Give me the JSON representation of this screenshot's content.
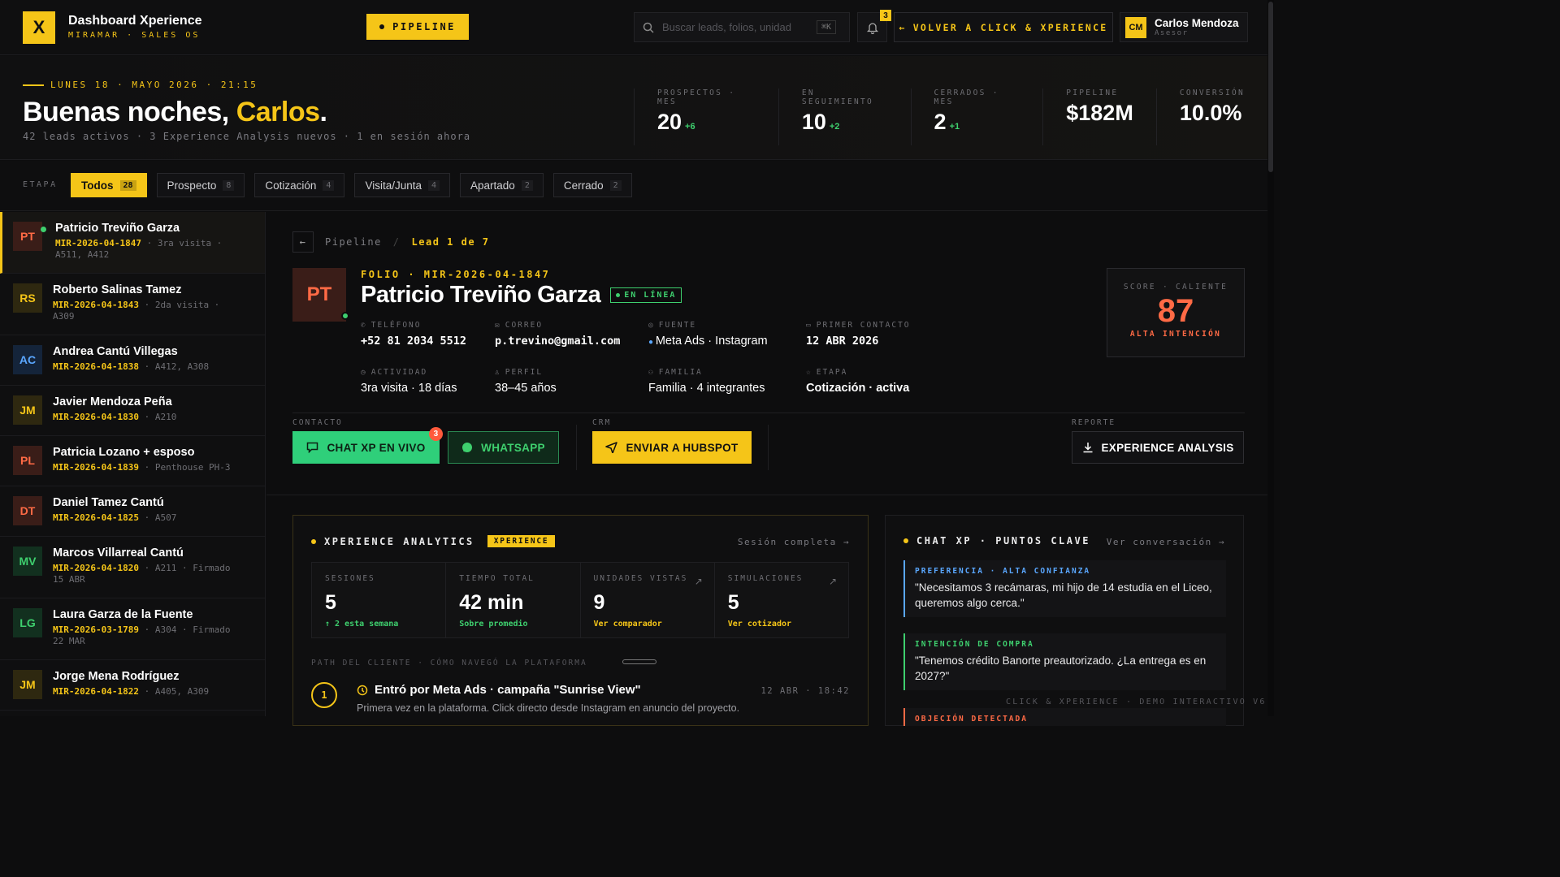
{
  "brand": {
    "logo": "X",
    "title": "Dashboard Xperience",
    "subtitle": "MIRAMAR · SALES OS"
  },
  "topbar": {
    "pipeline_label": "PIPELINE",
    "search_placeholder": "Buscar leads, folios, unidad",
    "search_shortcut": "⌘K",
    "notifications_count": "3",
    "back_label": "VOLVER A CLICK & XPERIENCE",
    "user": {
      "initials": "CM",
      "name": "Carlos Mendoza",
      "role": "Asesor"
    }
  },
  "hero": {
    "date": "LUNES 18 · MAYO 2026 · 21:15",
    "greeting_prefix": "Buenas noches, ",
    "greeting_name": "Carlos",
    "greeting_suffix": ".",
    "summary": "42 leads activos · 3 Experience Analysis nuevos · 1 en sesión ahora",
    "stats": [
      {
        "label": "PROSPECTOS · MES",
        "value": "20",
        "delta": "+6"
      },
      {
        "label": "EN SEGUIMIENTO",
        "value": "10",
        "delta": "+2"
      },
      {
        "label": "CERRADOS · MES",
        "value": "2",
        "delta": "+1"
      },
      {
        "label": "PIPELINE",
        "value": "$182M",
        "delta": ""
      },
      {
        "label": "CONVERSIÓN",
        "value": "10.0%",
        "delta": ""
      }
    ]
  },
  "stages": {
    "label": "ETAPA",
    "items": [
      {
        "label": "Todos",
        "count": "28"
      },
      {
        "label": "Prospecto",
        "count": "8"
      },
      {
        "label": "Cotización",
        "count": "4"
      },
      {
        "label": "Visita/Junta",
        "count": "4"
      },
      {
        "label": "Apartado",
        "count": "2"
      },
      {
        "label": "Cerrado",
        "count": "2"
      }
    ]
  },
  "leads": [
    {
      "initials": "PT",
      "name": "Patricio Treviño Garza",
      "folio": "MIR-2026-04-1847",
      "meta": " · 3ra visita · A511, A412",
      "color": "#ff6a45",
      "bg": "#3a1d18"
    },
    {
      "initials": "RS",
      "name": "Roberto Salinas Tamez",
      "folio": "MIR-2026-04-1843",
      "meta": " · 2da visita · A309",
      "color": "#f5c518",
      "bg": "#2e2810"
    },
    {
      "initials": "AC",
      "name": "Andrea Cantú Villegas",
      "folio": "MIR-2026-04-1838",
      "meta": " · A412, A308",
      "color": "#5aa7ff",
      "bg": "#14243a"
    },
    {
      "initials": "JM",
      "name": "Javier Mendoza Peña",
      "folio": "MIR-2026-04-1830",
      "meta": " · A210",
      "color": "#f5c518",
      "bg": "#2e2810"
    },
    {
      "initials": "PL",
      "name": "Patricia Lozano + esposo",
      "folio": "MIR-2026-04-1839",
      "meta": " · Penthouse PH-3",
      "color": "#ff6a45",
      "bg": "#3a1d18"
    },
    {
      "initials": "DT",
      "name": "Daniel Tamez Cantú",
      "folio": "MIR-2026-04-1825",
      "meta": " · A507",
      "color": "#ff6a45",
      "bg": "#3a1d18"
    },
    {
      "initials": "MV",
      "name": "Marcos Villarreal Cantú",
      "folio": "MIR-2026-04-1820",
      "meta": " · A211 · Firmado 15 ABR",
      "color": "#3ecf6e",
      "bg": "#12301f"
    },
    {
      "initials": "LG",
      "name": "Laura Garza de la Fuente",
      "folio": "MIR-2026-03-1789",
      "meta": " · A304 · Firmado 22 MAR",
      "color": "#3ecf6e",
      "bg": "#12301f"
    },
    {
      "initials": "JM",
      "name": "Jorge Mena Rodríguez",
      "folio": "MIR-2026-04-1822",
      "meta": " · A405, A309",
      "color": "#f5c518",
      "bg": "#2e2810"
    }
  ],
  "detail": {
    "breadcrumb_root": "Pipeline",
    "breadcrumb_sep": "/",
    "breadcrumb_current": "Lead 1 de 7",
    "initials": "PT",
    "folio": "FOLIO · MIR-2026-04-1847",
    "name": "Patricio Treviño Garza",
    "live_badge": "EN LÍNEA",
    "fields": [
      {
        "label": "TELÉFONO",
        "value": "+52 81 2034 5512",
        "icon": "phone-icon"
      },
      {
        "label": "CORREO",
        "value": "p.trevino@gmail.com",
        "icon": "mail-icon"
      },
      {
        "label": "FUENTE",
        "value": "Meta Ads · Instagram",
        "icon": "target-icon"
      },
      {
        "label": "PRIMER CONTACTO",
        "value": "12 ABR 2026",
        "icon": "calendar-icon"
      },
      {
        "label": "ACTIVIDAD",
        "value": "3ra visita · 18 días",
        "icon": "clock-icon"
      },
      {
        "label": "PERFIL",
        "value": "38–45 años",
        "icon": "user-icon"
      },
      {
        "label": "FAMILIA",
        "value": "Familia · 4 integrantes",
        "icon": "family-icon"
      },
      {
        "label": "ETAPA",
        "value": "Cotización · activa",
        "icon": "star-icon"
      }
    ],
    "score": {
      "label": "SCORE · CALIENTE",
      "value": "87",
      "sub": "ALTA INTENCIÓN"
    },
    "sections": {
      "contact": "CONTACTO",
      "crm": "CRM",
      "report": "REPORTE"
    },
    "actions": {
      "chat": "CHAT XP EN VIVO",
      "chat_badge": "3",
      "whatsapp": "WHATSAPP",
      "hubspot": "ENVIAR A HUBSPOT",
      "analysis": "EXPERIENCE ANALYSIS"
    }
  },
  "analytics": {
    "title": "XPERIENCE ANALYTICS",
    "tag": "XPERIENCE",
    "link": "Sesión completa →",
    "kpis": [
      {
        "label": "SESIONES",
        "value": "5",
        "sub": "↑ 2 esta semana",
        "color": "#3ecf6e"
      },
      {
        "label": "TIEMPO TOTAL",
        "value": "42 min",
        "sub": "Sobre promedio",
        "color": "#3ecf6e"
      },
      {
        "label": "UNIDADES VISTAS",
        "value": "9",
        "sub": "Ver comparador",
        "color": "#f5c518"
      },
      {
        "label": "SIMULACIONES",
        "value": "5",
        "sub": "Ver cotizador",
        "color": "#f5c518"
      }
    ],
    "path_label": "PATH DEL CLIENTE · CÓMO NAVEGÓ LA PLATAFORMA",
    "step": {
      "num": "1",
      "title": "Entró por Meta Ads · campaña \"Sunrise View\"",
      "time": "12 ABR · 18:42",
      "desc": "Primera vez en la plataforma. Click directo desde Instagram en anuncio del proyecto."
    }
  },
  "chatxp": {
    "title": "CHAT XP · PUNTOS CLAVE",
    "link": "Ver conversación →",
    "quotes": [
      {
        "label": "PREFERENCIA · ALTA CONFIANZA",
        "text": "\"Necesitamos 3 recámaras, mi hijo de 14 estudia en el Liceo, queremos algo cerca.\"",
        "color": "#5aa7ff"
      },
      {
        "label": "INTENCIÓN DE COMPRA",
        "text": "\"Tenemos crédito Banorte preautorizado. ¿La entrega es en 2027?\"",
        "color": "#3ecf6e"
      },
      {
        "label": "OBJECIÓN DETECTADA",
        "text": "",
        "color": "#ff6a45"
      }
    ]
  },
  "footer": "CLICK & XPERIENCE · DEMO INTERACTIVO V6",
  "colors": {
    "accent": "#f5c518",
    "success": "#3ecf6e",
    "danger": "#ff6a45",
    "bg": "#0d0d0e"
  }
}
